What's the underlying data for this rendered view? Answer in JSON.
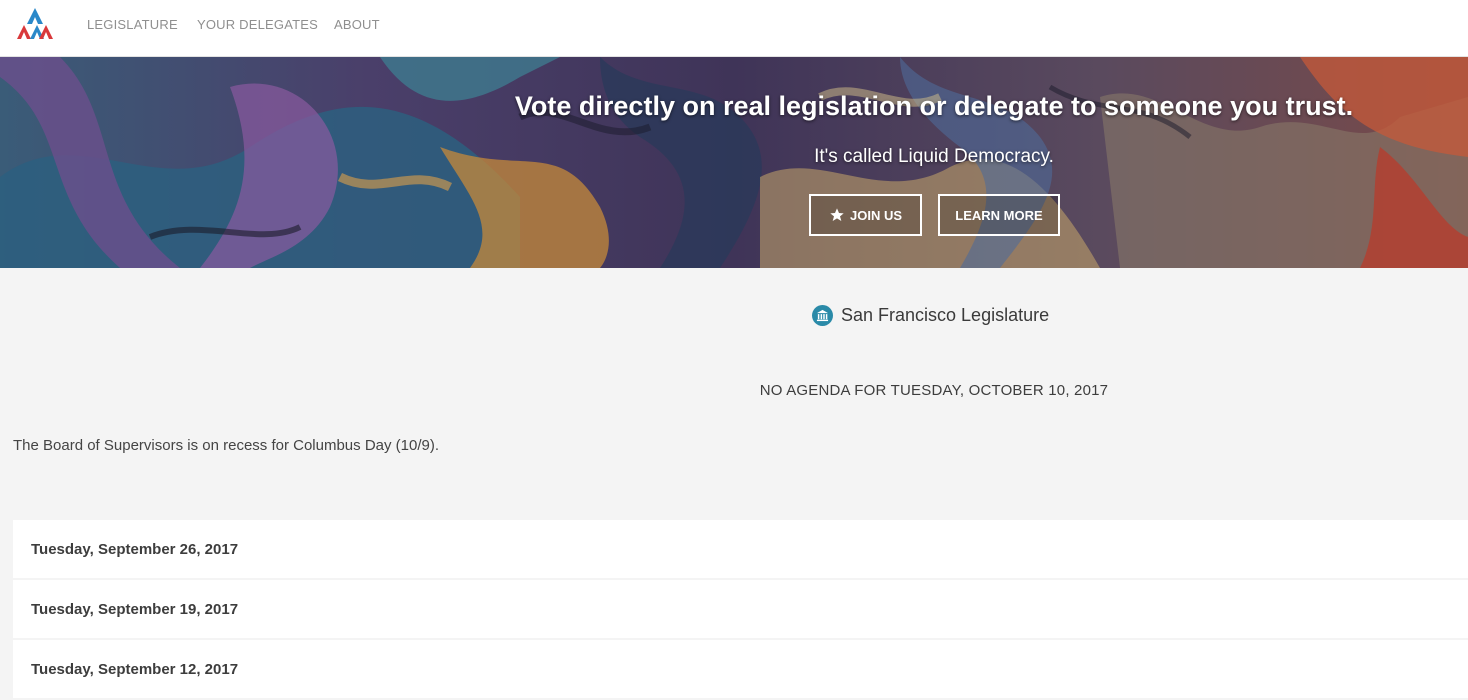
{
  "nav": {
    "logo_alt": "Liquid Democracy logo",
    "links": [
      {
        "label": "LEGISLATURE"
      },
      {
        "label": "YOUR DELEGATES"
      },
      {
        "label": "ABOUT"
      }
    ]
  },
  "hero": {
    "title": "Vote directly on real legislation or delegate to someone you trust.",
    "subtitle": "It's called Liquid Democracy.",
    "join_label": "JOIN US",
    "join_icon": "star-icon",
    "learn_label": "LEARN MORE"
  },
  "legislature": {
    "icon": "capitol-building-icon",
    "title": "San Francisco Legislature",
    "no_agenda": "NO AGENDA FOR TUESDAY, OCTOBER 10, 2017",
    "note": "The Board of Supervisors is on recess for Columbus Day (10/9)."
  },
  "meetings": [
    {
      "date": "Tuesday, September 26, 2017"
    },
    {
      "date": "Tuesday, September 19, 2017"
    },
    {
      "date": "Tuesday, September 12, 2017"
    }
  ],
  "colors": {
    "accent_blue": "#2a8aa8",
    "logo_red": "#d9393b",
    "logo_blue": "#2a88c9",
    "page_bg": "#f4f4f4"
  }
}
